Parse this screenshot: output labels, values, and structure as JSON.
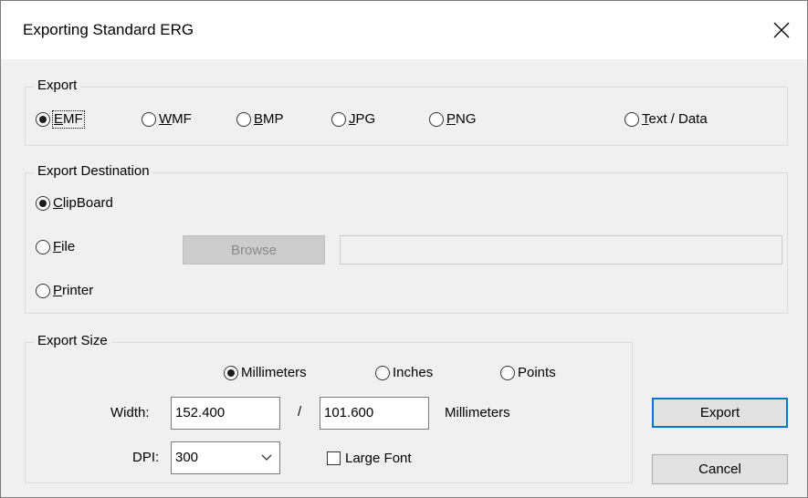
{
  "window": {
    "title": "Exporting Standard ERG"
  },
  "export_group": {
    "legend": "Export",
    "formats": [
      {
        "label": "EMF",
        "selected": true
      },
      {
        "label": "WMF",
        "selected": false
      },
      {
        "label": "BMP",
        "selected": false
      },
      {
        "label": "JPG",
        "selected": false
      },
      {
        "label": "PNG",
        "selected": false
      },
      {
        "label": "Text / Data",
        "selected": false
      }
    ]
  },
  "destination_group": {
    "legend": "Export Destination",
    "options": [
      {
        "label": "ClipBoard",
        "selected": true
      },
      {
        "label": "File",
        "selected": false
      },
      {
        "label": "Printer",
        "selected": false
      }
    ],
    "browse_label": "Browse",
    "file_path": ""
  },
  "size_group": {
    "legend": "Export Size",
    "units": [
      {
        "label": "Millimeters",
        "selected": true
      },
      {
        "label": "Inches",
        "selected": false
      },
      {
        "label": "Points",
        "selected": false
      }
    ],
    "width_label": "Width:",
    "width_value": "152.400",
    "separator": "/",
    "height_value": "101.600",
    "unit_label": "Millimeters",
    "dpi_label": "DPI:",
    "dpi_value": "300",
    "large_font_label": "Large Font",
    "large_font_checked": false
  },
  "buttons": {
    "export": "Export",
    "cancel": "Cancel"
  }
}
